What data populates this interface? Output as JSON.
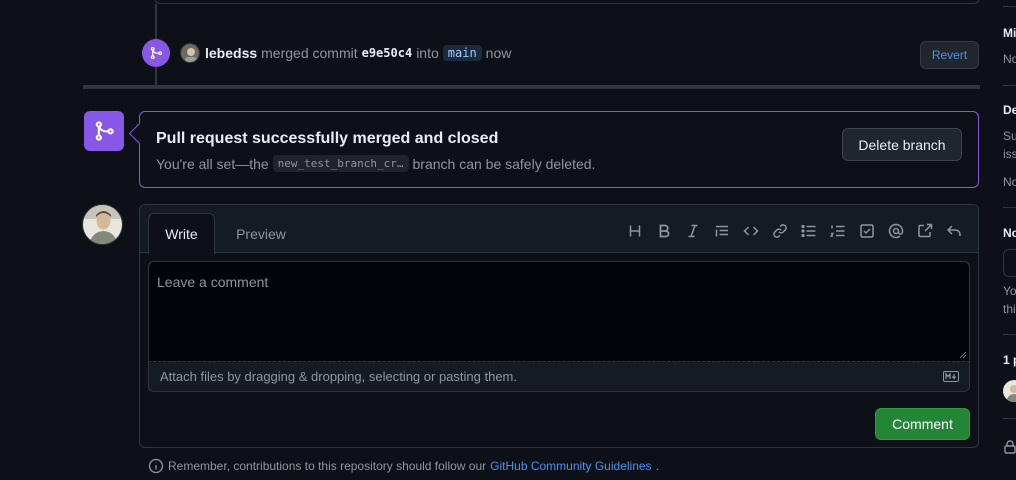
{
  "timeline_event": {
    "author": "lebedss",
    "action": "merged commit",
    "commit": "e9e50c4",
    "into": "into",
    "branch": "main",
    "time": "now",
    "revert_label": "Revert"
  },
  "merge_status": {
    "title": "Pull request successfully merged and closed",
    "sub_prefix": "You're all set—the",
    "branch": "new_test_branch_cr…",
    "sub_suffix": "branch can be safely deleted.",
    "delete_label": "Delete branch"
  },
  "composer": {
    "tabs": [
      {
        "label": "Write",
        "active": true
      },
      {
        "label": "Preview",
        "active": false
      }
    ],
    "placeholder": "Leave a comment",
    "attach_hint": "Attach files by dragging & dropping, selecting or pasting them.",
    "submit_label": "Comment",
    "toolbar": [
      "heading-icon",
      "bold-icon",
      "italic-icon",
      "quote-icon",
      "code-icon",
      "link-icon",
      "unordered-list-icon",
      "ordered-list-icon",
      "task-list-icon",
      "mention-icon",
      "cross-reference-icon",
      "saved-reply-icon"
    ]
  },
  "footer": {
    "prefix": "Remember, contributions to this repository should follow our",
    "link": "GitHub Community Guidelines",
    "suffix": "."
  },
  "sidebar": {
    "h1": "Mi",
    "t1": "No",
    "h2": "De",
    "t2a": "Su",
    "t2b": "iss",
    "t2c": "No",
    "h3": "No",
    "t3a": "Yo",
    "t3b": "thi",
    "h4": "1 p"
  },
  "colors": {
    "merged": "#8957e5",
    "accent_link": "#4493f8",
    "primary_button": "#238636",
    "background": "#0d1117"
  }
}
